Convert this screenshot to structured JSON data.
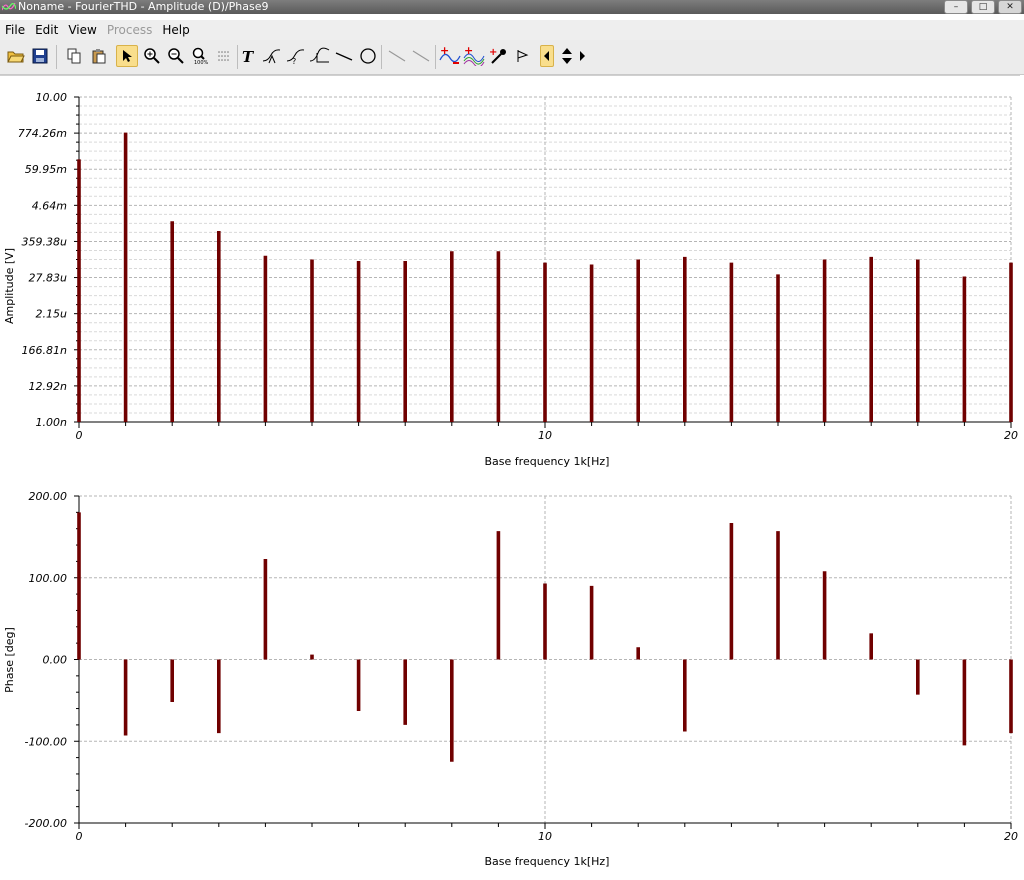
{
  "window": {
    "title": "Noname - FourierTHD - Amplitude (D)/Phase9",
    "buttons": [
      "minimize",
      "maximize",
      "close"
    ]
  },
  "menu": [
    {
      "label": "File",
      "enabled": true
    },
    {
      "label": "Edit",
      "enabled": true
    },
    {
      "label": "View",
      "enabled": true
    },
    {
      "label": "Process",
      "enabled": false
    },
    {
      "label": "Help",
      "enabled": true
    }
  ],
  "toolbar": {
    "tools": [
      "open-icon",
      "save-icon",
      "copy-icon",
      "paste-icon",
      "pointer-icon",
      "zoom-in-icon",
      "zoom-out-icon",
      "zoom-100-icon",
      "grid-icon",
      "text-icon",
      "marker-1-icon",
      "marker-2-icon",
      "marker-3-icon",
      "line-icon",
      "circle-icon",
      "slope-1-icon",
      "slope-2-icon",
      "add-curve-icon",
      "add-wave-icon",
      "picker-icon",
      "flag-icon",
      "prev-icon",
      "up-down-icon",
      "next-icon"
    ],
    "active_tool": "pointer-icon"
  },
  "chart_data": [
    {
      "type": "bar",
      "ylabel": "Amplitude [V]",
      "xlabel": "Base frequency 1k[Hz]",
      "yscale": "log",
      "ylim": [
        1e-09,
        10
      ],
      "xlim": [
        0,
        20
      ],
      "x_tick_labels": [
        "0",
        "10",
        "20"
      ],
      "y_tick_labels": [
        "10.00",
        "774.26m",
        "59.95m",
        "4.64m",
        "359.38u",
        "27.83u",
        "2.15u",
        "166.81n",
        "12.92n",
        "1.00n"
      ],
      "grid": true,
      "color": "#700000",
      "x": [
        0,
        1,
        2,
        3,
        4,
        5,
        6,
        7,
        8,
        9,
        10,
        11,
        12,
        13,
        14,
        15,
        16,
        17,
        18,
        19,
        20
      ],
      "values": [
        0.12,
        0.8,
        0.0015,
        0.00075,
        0.00013,
        0.0001,
        9e-05,
        9e-05,
        0.00018,
        0.00018,
        8e-05,
        7e-05,
        0.0001,
        0.00012,
        8e-05,
        3.5e-05,
        0.0001,
        0.00012,
        0.0001,
        3e-05,
        8e-05
      ]
    },
    {
      "type": "bar",
      "ylabel": "Phase [deg]",
      "xlabel": "Base frequency 1k[Hz]",
      "ylim": [
        -200,
        200
      ],
      "xlim": [
        0,
        20
      ],
      "x_tick_labels": [
        "0",
        "10",
        "20"
      ],
      "y_tick_labels": [
        "200.00",
        "100.00",
        "0.00",
        "-100.00",
        "-200.00"
      ],
      "grid": true,
      "color": "#700000",
      "x": [
        0,
        1,
        2,
        3,
        4,
        5,
        6,
        7,
        8,
        9,
        10,
        11,
        12,
        13,
        14,
        15,
        16,
        17,
        18,
        19,
        20
      ],
      "values": [
        180,
        -93,
        -52,
        -90,
        123,
        6,
        -63,
        -80,
        -125,
        157,
        93,
        90,
        15,
        -88,
        167,
        157,
        108,
        32,
        -43,
        -105,
        -90
      ]
    }
  ]
}
